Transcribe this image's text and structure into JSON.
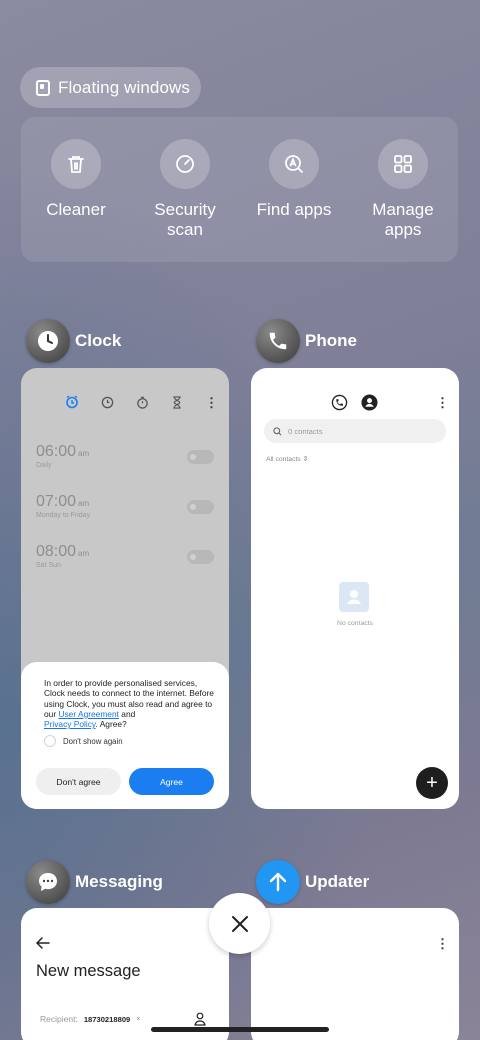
{
  "floating_windows": {
    "label": "Floating windows",
    "icon": "floating-window-icon"
  },
  "tools": [
    {
      "label": "Cleaner",
      "icon": "trash-icon"
    },
    {
      "label": "Security scan",
      "icon": "gauge-icon"
    },
    {
      "label": "Find apps",
      "icon": "search-apps-icon"
    },
    {
      "label": "Manage apps",
      "icon": "grid-icon"
    }
  ],
  "apps": {
    "clock": {
      "name": "Clock",
      "alarms": [
        {
          "time": "06:00",
          "ampm": "am",
          "repeat": "Daily"
        },
        {
          "time": "07:00",
          "ampm": "am",
          "repeat": "Monday to Friday"
        },
        {
          "time": "08:00",
          "ampm": "am",
          "repeat": "Sat Sun"
        }
      ],
      "dialog": {
        "text": "In order to provide personalised services, Clock needs to connect to the internet. Before using Clock, you must also read and agree to our",
        "link1": "User Agreement",
        "and": "and",
        "link2": "Privacy Policy",
        "agree_q": ". Agree?",
        "checkbox": "Don't show again",
        "btn_no": "Don't agree",
        "btn_yes": "Agree"
      }
    },
    "phone": {
      "name": "Phone",
      "search_placeholder": "0 contacts",
      "filter": "All contacts",
      "empty": "No contacts",
      "fab": "+"
    },
    "messaging": {
      "name": "Messaging",
      "title": "New message",
      "recipient_label": "Recipient:",
      "recipient_chip": "18730218809"
    },
    "updater": {
      "name": "Updater"
    }
  },
  "colors": {
    "accent": "#1a7ef0",
    "updater_icon": "#2196f3"
  }
}
